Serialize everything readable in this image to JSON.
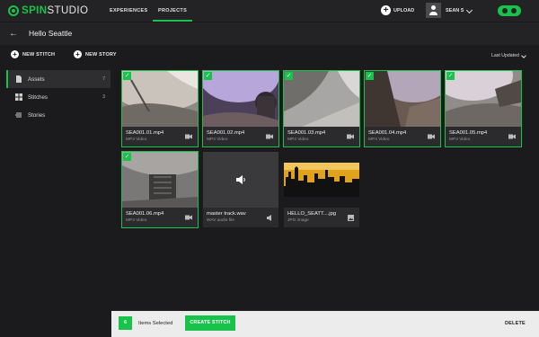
{
  "app": {
    "logo_spin": "SPIN",
    "logo_studio": "STUDIO",
    "nav": {
      "experiences": "EXPERIENCES",
      "projects": "PROJECTS"
    },
    "upload": "UPLOAD",
    "user_name": "SEAN S",
    "accent_color": "#18c24b"
  },
  "page": {
    "title": "Hello Seattle",
    "new_stitch": "NEW STITCH",
    "new_story": "NEW STORY",
    "sort": "Last Updated"
  },
  "sidebar": {
    "items": [
      {
        "label": "Assets",
        "count": "7",
        "icon": "assets-icon",
        "active": true
      },
      {
        "label": "Stitches",
        "count": "3",
        "icon": "stitches-icon",
        "active": false
      },
      {
        "label": "Stories",
        "count": "",
        "icon": "stories-icon",
        "active": false
      }
    ]
  },
  "assets": [
    {
      "name": "SEA001.01.mp4",
      "type": "MP4 Video",
      "selected": true,
      "icon": "video-camera-icon"
    },
    {
      "name": "SEA001.02.mp4",
      "type": "MP4 Video",
      "selected": true,
      "icon": "video-camera-icon"
    },
    {
      "name": "SEA001.03.mp4",
      "type": "MP4 Video",
      "selected": true,
      "icon": "video-camera-icon"
    },
    {
      "name": "SEA001.04.mp4",
      "type": "MP4 Video",
      "selected": true,
      "icon": "video-camera-icon"
    },
    {
      "name": "SEA001.05.mp4",
      "type": "MP4 Video",
      "selected": true,
      "icon": "video-camera-icon"
    },
    {
      "name": "SEA001.06.mp4",
      "type": "MP4 Video",
      "selected": true,
      "icon": "video-camera-icon"
    },
    {
      "name": "master track.wav",
      "type": "WAV audio file",
      "selected": false,
      "icon": "speaker-icon"
    },
    {
      "name": "HELLO_SEATT....jpg",
      "type": "JPG image",
      "selected": false,
      "icon": "image-icon"
    }
  ],
  "bottom_bar": {
    "count": "6",
    "label": "Items Selected",
    "create": "CREATE STITCH",
    "delete": "DELETE"
  }
}
